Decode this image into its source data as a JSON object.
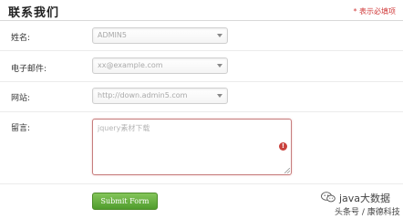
{
  "header": {
    "title": "联系我们",
    "required_note": "* 表示必填项"
  },
  "form": {
    "name": {
      "label": "姓名:",
      "value": "ADMIN5"
    },
    "email": {
      "label": "电子邮件:",
      "placeholder": "xx@example.com"
    },
    "website": {
      "label": "网站:",
      "placeholder": "http://down.admin5.com"
    },
    "message": {
      "label": "留言:",
      "placeholder": "jquery素材下载"
    },
    "submit_label": "Submit Form"
  },
  "watermark": {
    "top": "java大数据",
    "bottom": "头条号 / 康德科技"
  },
  "colors": {
    "accent_green": "#5aa833",
    "error_red": "#c9413c",
    "required_red": "#d03a3a"
  }
}
